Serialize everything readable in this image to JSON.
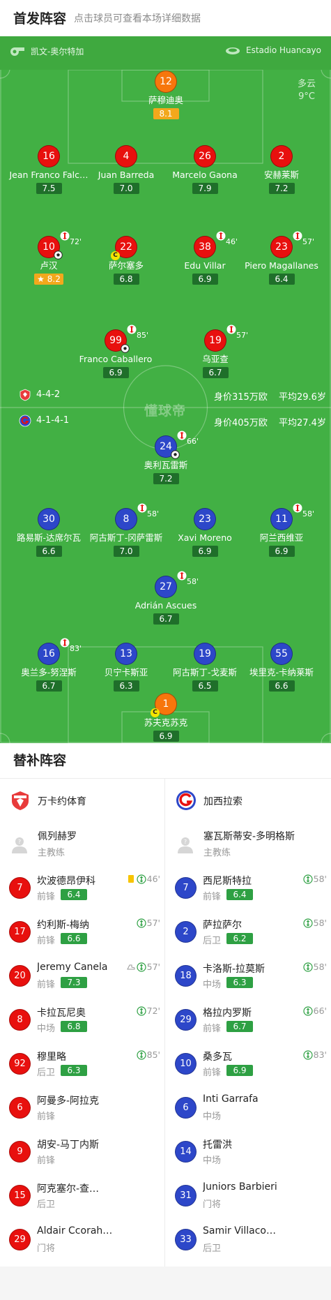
{
  "header": {
    "title": "首发阵容",
    "subtitle": "点击球员可查看本场详细数据"
  },
  "match_info": {
    "referee": "凯文-奥尔特加",
    "stadium": "Estadio Huancayo",
    "weather": "多云",
    "temperature": "9°C"
  },
  "watermark": "懂球帝",
  "colors": {
    "pitch": "#42b044",
    "home": "#e8100e",
    "away": "#2d47c9",
    "goalkeeper": "#f7760c",
    "rating": "#1f6f2a",
    "best_rating": "#f2a81c",
    "sub_rating": "#2ea043"
  },
  "home_formation": {
    "formation": "4-4-2",
    "value": "身价315万欧",
    "age": "平均29.6岁"
  },
  "away_formation": {
    "formation": "4-1-4-1",
    "value": "身价405万欧",
    "age": "平均27.4岁"
  },
  "home_players": [
    {
      "number": "12",
      "name": "萨穆迪奥",
      "rating": "8.1"
    },
    {
      "number": "16",
      "name": "Jean Franco Falc…",
      "rating": "7.5"
    },
    {
      "number": "4",
      "name": "Juan Barreda",
      "rating": "7.0"
    },
    {
      "number": "26",
      "name": "Marcelo Gaona",
      "rating": "7.9"
    },
    {
      "number": "2",
      "name": "安赫莱斯",
      "rating": "7.2"
    },
    {
      "number": "10",
      "name": "卢汉",
      "rating": "8.2",
      "sub_min": "72'"
    },
    {
      "number": "22",
      "name": "萨尔塞多",
      "rating": "6.8"
    },
    {
      "number": "38",
      "name": "Edu Villar",
      "rating": "6.9",
      "sub_min": "46'"
    },
    {
      "number": "23",
      "name": "Piero Magallanes",
      "rating": "6.4",
      "sub_min": "57'"
    },
    {
      "number": "99",
      "name": "Franco Caballero",
      "rating": "6.9",
      "sub_min": "85'"
    },
    {
      "number": "19",
      "name": "乌亚查",
      "rating": "6.7",
      "sub_min": "57'"
    }
  ],
  "away_players": [
    {
      "number": "24",
      "name": "奥利瓦雷斯",
      "rating": "7.2",
      "sub_min": "66'"
    },
    {
      "number": "30",
      "name": "路易斯-达席尔瓦",
      "rating": "6.6"
    },
    {
      "number": "8",
      "name": "阿古斯丁-冈萨雷斯",
      "rating": "7.0",
      "sub_min": "58'"
    },
    {
      "number": "23",
      "name": "Xavi Moreno",
      "rating": "6.9"
    },
    {
      "number": "11",
      "name": "阿兰西维亚",
      "rating": "6.9",
      "sub_min": "58'"
    },
    {
      "number": "27",
      "name": "Adrián Ascues",
      "rating": "6.7",
      "sub_min": "58'"
    },
    {
      "number": "16",
      "name": "奥兰多-努涅斯",
      "rating": "6.7",
      "sub_min": "83'"
    },
    {
      "number": "13",
      "name": "贝宁卡斯亚",
      "rating": "6.3"
    },
    {
      "number": "19",
      "name": "阿古斯丁-戈麦斯",
      "rating": "6.5"
    },
    {
      "number": "55",
      "name": "埃里克-卡纳莱斯",
      "rating": "6.6"
    },
    {
      "number": "1",
      "name": "苏夫克苏克",
      "rating": "6.9"
    }
  ],
  "subs_title": "替补阵容",
  "home_bench": {
    "team": "万卡约体育",
    "coach": {
      "name": "佩列赫罗",
      "role": "主教练"
    },
    "subs": [
      {
        "number": "7",
        "name": "坎波德昂伊科",
        "pos": "前锋",
        "rating": "6.4",
        "min": "46'"
      },
      {
        "number": "17",
        "name": "约利斯-梅纳",
        "pos": "前锋",
        "rating": "6.6",
        "min": "57'"
      },
      {
        "number": "20",
        "name": "Jeremy Canela",
        "pos": "前锋",
        "rating": "7.3",
        "min": "57'"
      },
      {
        "number": "8",
        "name": "卡拉瓦尼奥",
        "pos": "中场",
        "rating": "6.8",
        "min": "72'"
      },
      {
        "number": "92",
        "name": "穆里略",
        "pos": "后卫",
        "rating": "6.3",
        "min": "85'"
      },
      {
        "number": "6",
        "name": "阿曼多-阿拉克",
        "pos": "前锋"
      },
      {
        "number": "9",
        "name": "胡安-马丁内斯",
        "pos": "前锋"
      },
      {
        "number": "15",
        "name": "阿克塞尔-查…",
        "pos": "后卫"
      },
      {
        "number": "29",
        "name": "Aldair Ccorahua",
        "pos": "门将"
      }
    ]
  },
  "away_bench": {
    "team": "加西拉索",
    "coach": {
      "name": "塞瓦斯蒂安-多明格斯",
      "role": "主教练"
    },
    "subs": [
      {
        "number": "7",
        "name": "西尼斯特拉",
        "pos": "前锋",
        "rating": "6.4",
        "min": "58'"
      },
      {
        "number": "2",
        "name": "萨拉萨尔",
        "pos": "后卫",
        "rating": "6.2",
        "min": "58'"
      },
      {
        "number": "18",
        "name": "卡洛斯-拉莫斯",
        "pos": "中场",
        "rating": "6.3",
        "min": "58'"
      },
      {
        "number": "29",
        "name": "格拉内罗斯",
        "pos": "前锋",
        "rating": "6.7",
        "min": "66'"
      },
      {
        "number": "10",
        "name": "桑多瓦",
        "pos": "前锋",
        "rating": "6.9",
        "min": "83'"
      },
      {
        "number": "6",
        "name": "Inti Garrafa",
        "pos": "中场"
      },
      {
        "number": "14",
        "name": "托雷洪",
        "pos": "中场"
      },
      {
        "number": "31",
        "name": "Juniors Barbieri",
        "pos": "门将"
      },
      {
        "number": "33",
        "name": "Samir Villacorta",
        "pos": "后卫"
      }
    ]
  }
}
